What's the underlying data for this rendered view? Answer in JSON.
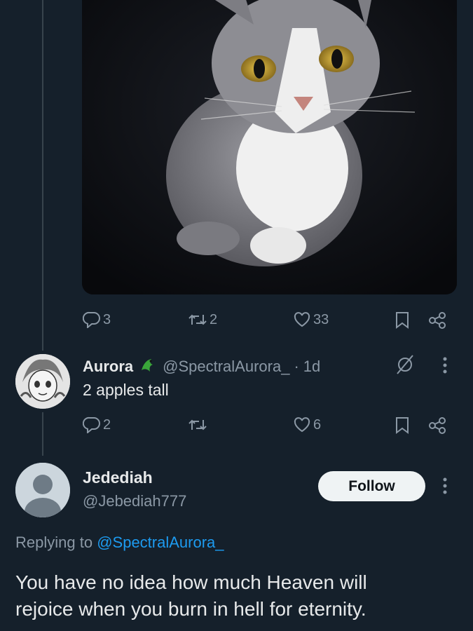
{
  "post1": {
    "photo_alt": "cat",
    "actions": {
      "replies": "3",
      "reposts": "2",
      "likes": "33"
    }
  },
  "reply1": {
    "display_name": "Aurora",
    "handle": "@SpectralAurora_",
    "dot": "·",
    "time": "1d",
    "text": "2 apples tall",
    "actions": {
      "replies": "2",
      "reposts": "",
      "likes": "6"
    }
  },
  "reply2": {
    "display_name": "Jedediah",
    "handle": "@Jebediah777",
    "follow_label": "Follow",
    "replying_prefix": "Replying to",
    "replying_handle": "@SpectralAurora_",
    "text_line1": "You have no idea how much Heaven will",
    "text_line2": "rejoice when you burn in hell for eternity."
  },
  "colors": {
    "background": "#15202b",
    "link": "#1d9bf0",
    "secondary_text": "#8b98a5",
    "follow_bg": "#eff3f4"
  }
}
